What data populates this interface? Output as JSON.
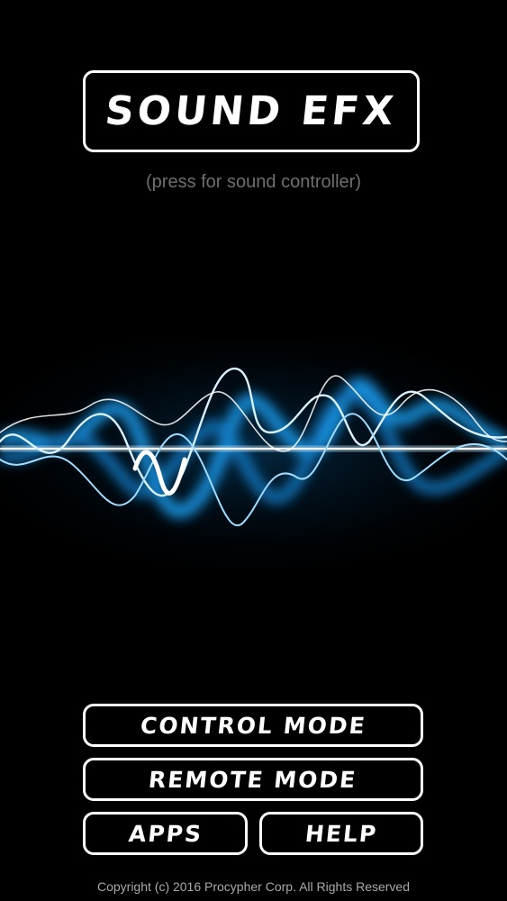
{
  "title_button": {
    "label": "SOUND EFX"
  },
  "subtitle": "(press for sound controller)",
  "buttons": {
    "control_mode": "CONTROL MODE",
    "remote_mode": "REMOTE MODE",
    "apps": "APPS",
    "help": "HELP"
  },
  "footer": {
    "copyright": "Copyright (c) 2016 Procypher Corp. All Rights Reserved"
  },
  "colors": {
    "background": "#000000",
    "foreground": "#ffffff",
    "subtitle": "#6f6f6f",
    "wave_glow": "#1ea8ff"
  },
  "icons": {
    "wave": "sound-wave-graphic"
  }
}
